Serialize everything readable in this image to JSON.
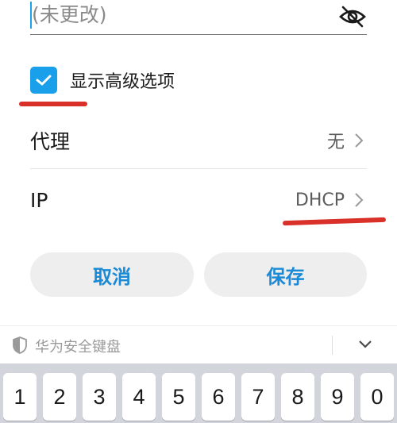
{
  "password_field": {
    "value": "(未更改)",
    "visibility_icon": "eye-off-icon"
  },
  "advanced": {
    "label": "显示高级选项",
    "checked": true,
    "check_color": "#1aa0ea"
  },
  "proxy": {
    "label": "代理",
    "value": "无"
  },
  "ip": {
    "label": "IP",
    "value": "DHCP"
  },
  "buttons": {
    "cancel": "取消",
    "save": "保存",
    "accent": "#1b8ad6"
  },
  "keyboard": {
    "title": "华为安全键盘",
    "keys": [
      "1",
      "2",
      "3",
      "4",
      "5",
      "6",
      "7",
      "8",
      "9",
      "0"
    ]
  },
  "annotation_color": "#d9302a"
}
